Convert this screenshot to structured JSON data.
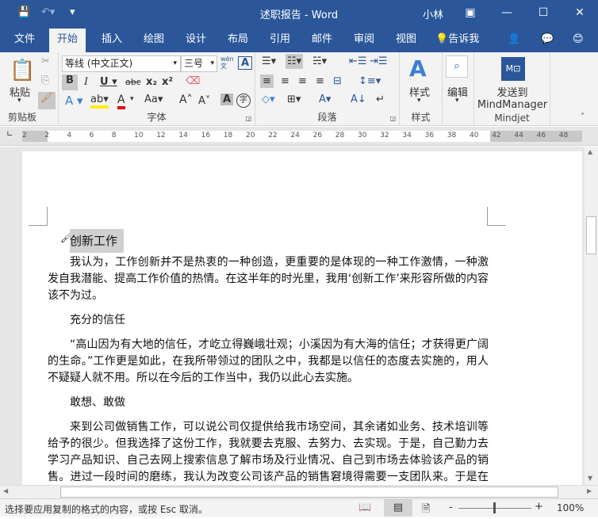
{
  "title": "述职报告 - Word",
  "user": "小林",
  "tabs": [
    "文件",
    "开始",
    "插入",
    "绘图",
    "设计",
    "布局",
    "引用",
    "邮件",
    "审阅",
    "视图",
    "告诉我"
  ],
  "ribbon": {
    "clipboard": {
      "paste": "粘贴",
      "label": "剪贴板"
    },
    "font": {
      "name": "等线 (中文正文)",
      "size": "三号",
      "label": "字体",
      "phonetic": "wén\n文"
    },
    "paragraph": {
      "label": "段落"
    },
    "styles": {
      "button": "样式",
      "label": "样式"
    },
    "editing": {
      "button": "编辑"
    },
    "mindjet": {
      "button_line1": "发送到",
      "button_line2": "MindManager",
      "label": "Mindjet"
    }
  },
  "ruler": {
    "ticks": [
      "2",
      "2",
      "4",
      "6",
      "8",
      "10",
      "12",
      "14",
      "16",
      "18",
      "20",
      "22",
      "24",
      "26",
      "28",
      "30",
      "32",
      "34",
      "36",
      "38",
      "40",
      "42",
      "44",
      "46",
      "48"
    ]
  },
  "document": {
    "heading": "创新工作",
    "p1": "我认为，工作创新并不是热衷的一种创造，更重要的是体现的一种工作激情，一种激发自我潜能、提高工作价值的热情。在这半年的时光里，我用‘创新工作’来形容所做的内容该不为过。",
    "h2": "充分的信任",
    "p2": "“高山因为有大地的信任，才屹立得巍峨壮观；小溪因为有大海的信任；才获得更广阔的生命。”工作更是如此，在我所带领过的团队之中，我都是以信任的态度去实施的，用人不疑疑人就不用。所以在今后的工作当中，我仍以此心去实施。",
    "h3": "敢想、敢做",
    "p3": "来到公司做销售工作，可以说公司仅提供给我市场空间，其余诸如业务、技术培训等给予的很少。但我选择了这份工作，我就要去克服、去努力、去实现。于是，自己勤力去学习产品知识、自己去网上搜索信息了解市场及行业情况、自己到市场去体验该产品的销售。进过一段时间的磨练，我认为改变公司该产品的销售窘境得需要一支团队来。于是在顶着一些压力下我开始组建自己的销售团队并招聘了一批对工作有热情的年轻人，这支团队在后来的销售中起了至关重要的作用。"
  },
  "status": {
    "message": "选择要应用复制的格式的内容，或按 Esc 取消。",
    "zoom": "100%"
  }
}
